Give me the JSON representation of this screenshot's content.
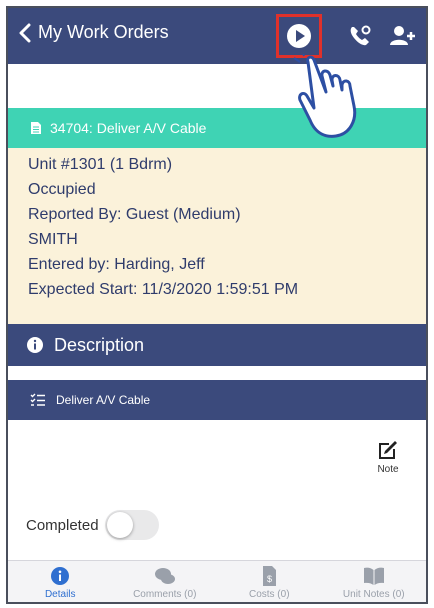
{
  "header": {
    "back_label": "My Work Orders",
    "icons": [
      "chevron-left-icon",
      "play-icon",
      "phone-icon",
      "add-user-icon"
    ],
    "highlight_color": "#e0312b",
    "bar_color": "#3b4a7c"
  },
  "work_order": {
    "title": "34704: Deliver A/V Cable",
    "header_color": "#3fd3b4",
    "details": [
      "Unit #1301 (1 Bdrm)",
      "Occupied",
      "Reported By: Guest  (Medium)",
      "SMITH",
      "Entered by: Harding, Jeff",
      "Expected Start: 11/3/2020 1:59:51 PM"
    ]
  },
  "description": {
    "label": "Description"
  },
  "task": {
    "label": "Deliver A/V Cable",
    "note_label": "Note",
    "completed_label": "Completed",
    "completed": false
  },
  "tabs": [
    {
      "label": "Details",
      "icon": "info-icon",
      "active": true
    },
    {
      "label": "Comments (0)",
      "icon": "comments-icon",
      "active": false
    },
    {
      "label": "Costs (0)",
      "icon": "costs-icon",
      "active": false
    },
    {
      "label": "Unit Notes (0)",
      "icon": "book-icon",
      "active": false
    }
  ]
}
